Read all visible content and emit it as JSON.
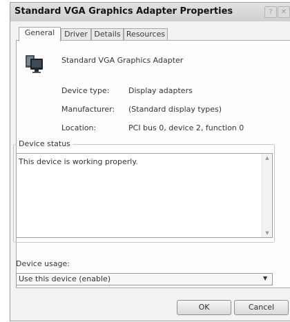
{
  "window": {
    "title": "Standard VGA Graphics Adapter Properties"
  },
  "tabs": [
    {
      "label": "General",
      "active": true
    },
    {
      "label": "Driver"
    },
    {
      "label": "Details"
    },
    {
      "label": "Resources"
    }
  ],
  "device": {
    "name": "Standard VGA Graphics Adapter",
    "icon": "display-monitor-icon",
    "properties": [
      {
        "label": "Device type:",
        "value": "Display adapters"
      },
      {
        "label": "Manufacturer:",
        "value": "(Standard display types)"
      },
      {
        "label": "Location:",
        "value": "PCI bus 0, device 2, function 0"
      }
    ]
  },
  "status": {
    "label": "Device status",
    "text": "This device is working properly."
  },
  "usage": {
    "label": "Device usage:",
    "selected": "Use this device (enable)"
  },
  "buttons": {
    "ok": "OK",
    "cancel": "Cancel"
  }
}
